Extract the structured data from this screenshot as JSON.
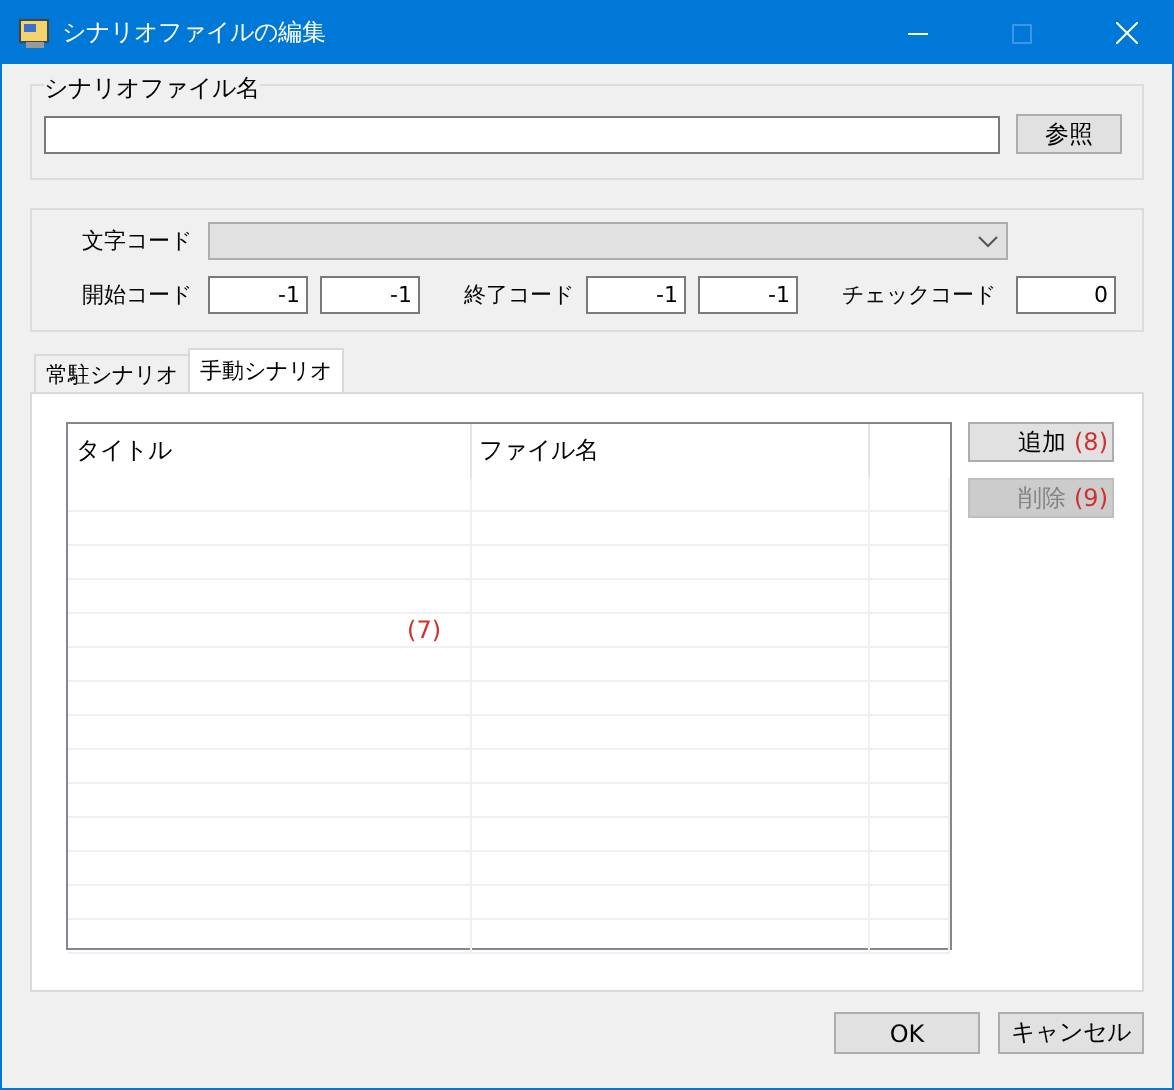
{
  "window": {
    "title": "シナリオファイルの編集"
  },
  "file_group": {
    "label": "シナリオファイル名",
    "browse_button": "参照"
  },
  "code_group": {
    "charset_label": "文字コード",
    "start_label": "開始コード",
    "start_values": [
      "-1",
      "-1"
    ],
    "end_label": "終了コード",
    "end_values": [
      "-1",
      "-1"
    ],
    "check_label": "チェックコード",
    "check_value": "0"
  },
  "tabs": [
    {
      "label": "常駐シナリオ",
      "selected": false
    },
    {
      "label": "手動シナリオ",
      "selected": true
    }
  ],
  "table": {
    "columns": [
      "タイトル",
      "ファイル名"
    ],
    "marker": "(7)"
  },
  "side_buttons": [
    {
      "label": "追加",
      "marker": "(8)",
      "disabled": false
    },
    {
      "label": "削除",
      "marker": "(9)",
      "disabled": true
    }
  ],
  "buttons": [
    "OK",
    "キャンセル"
  ]
}
